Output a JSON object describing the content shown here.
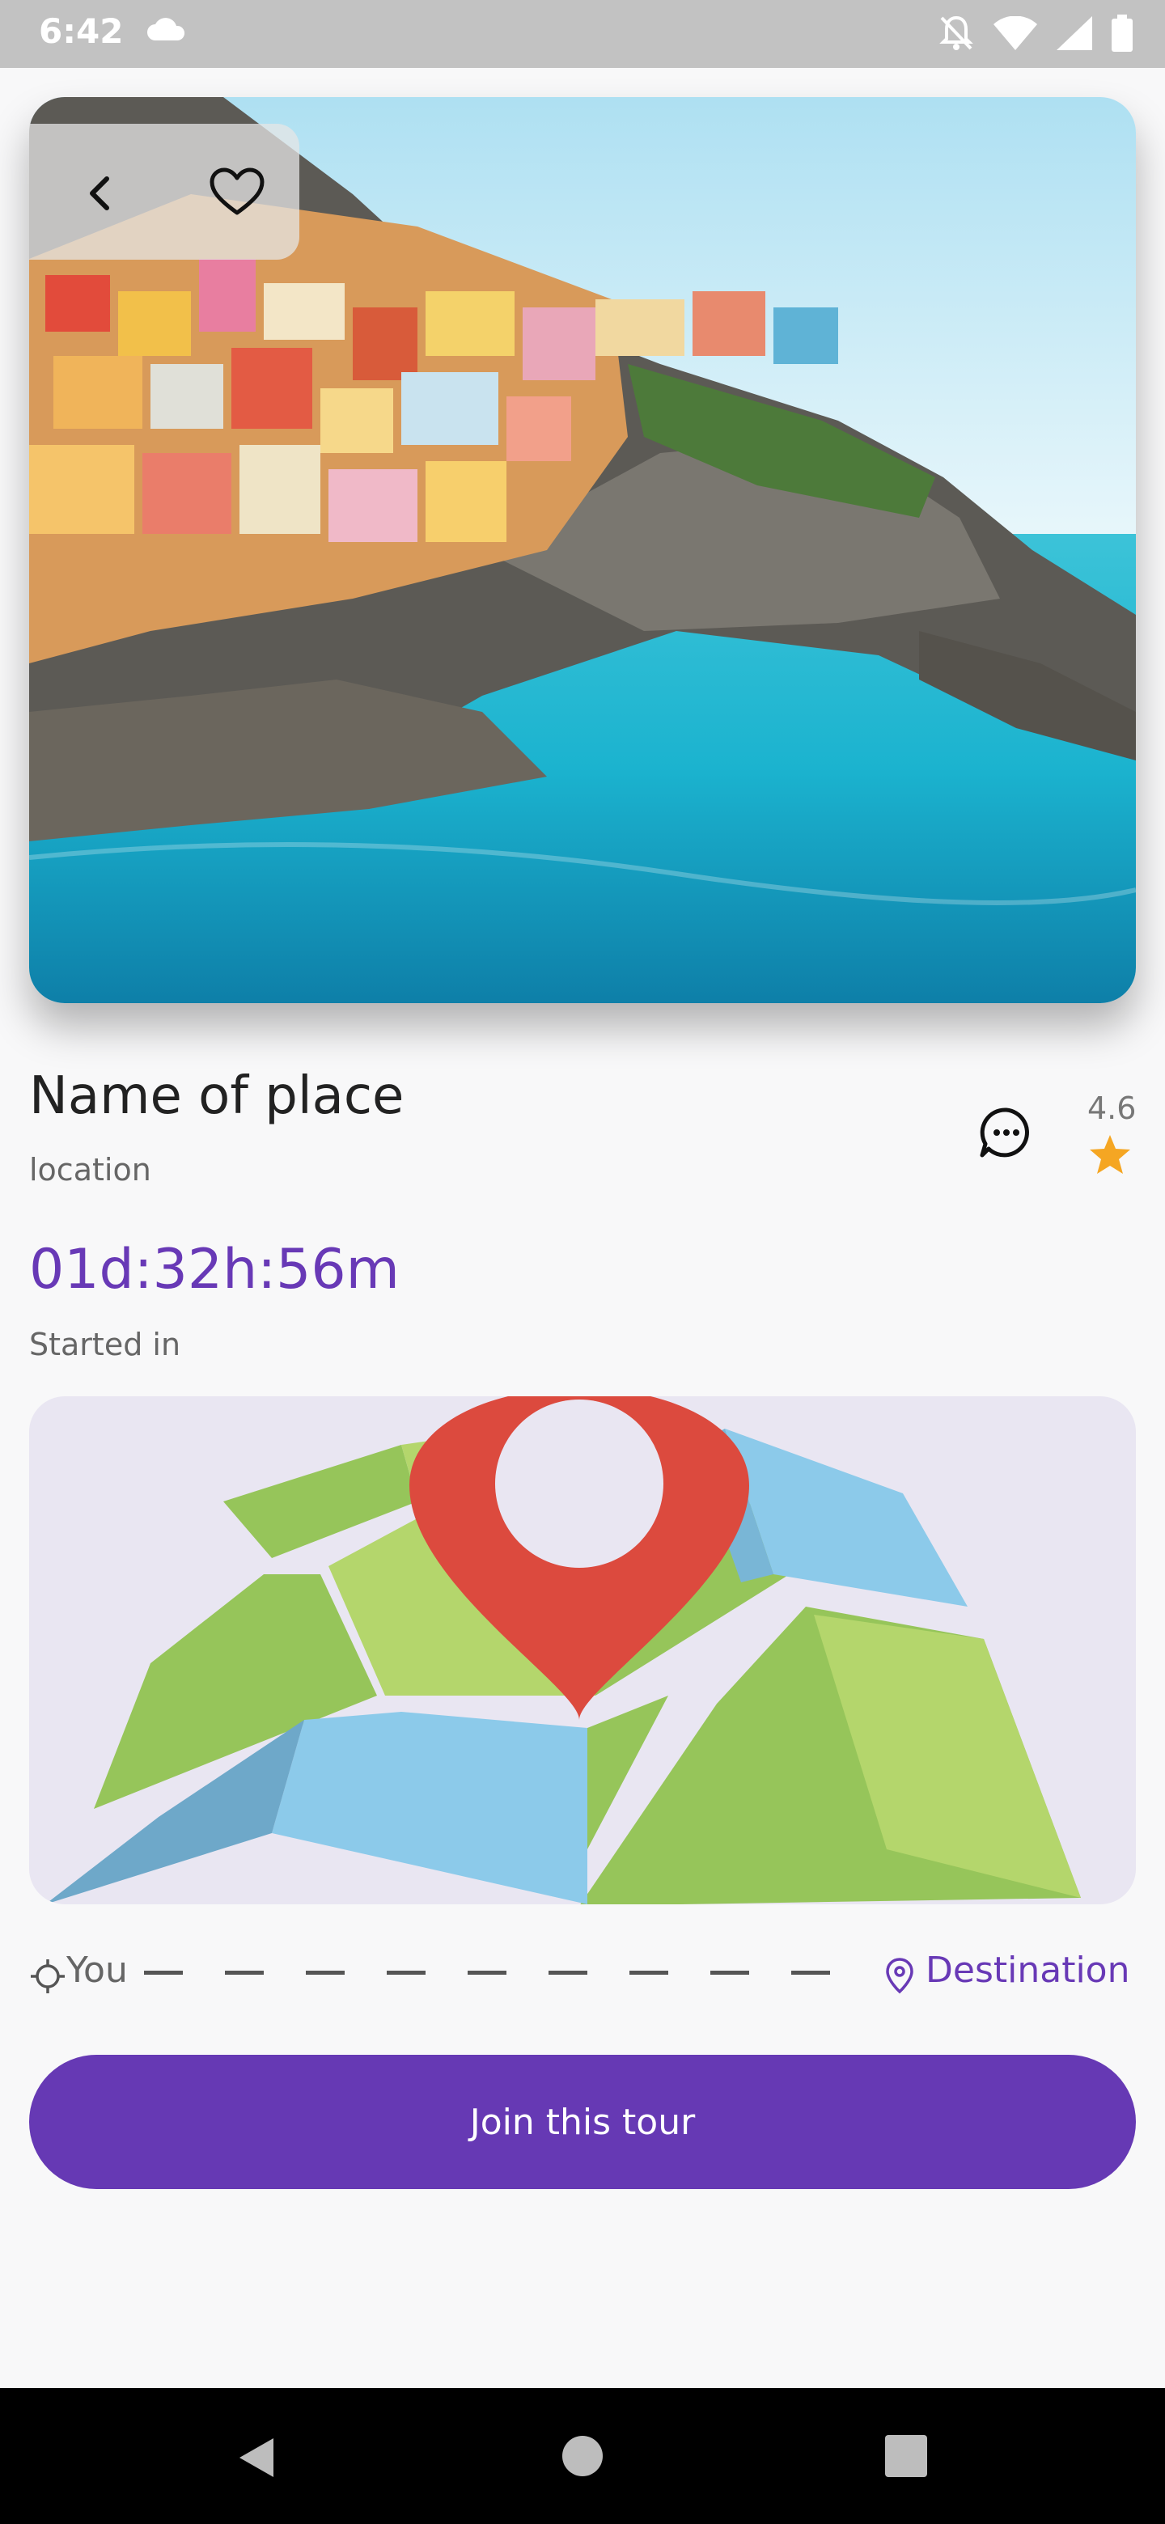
{
  "status_bar": {
    "time": "6:42"
  },
  "place": {
    "name": "Name of place",
    "location": "location",
    "rating": "4.6"
  },
  "tour": {
    "countdown": "01d:32h:56m",
    "started_label": "Started in"
  },
  "route": {
    "start_label": "You",
    "end_label": "Destination"
  },
  "actions": {
    "join_label": "Join this tour"
  },
  "colors": {
    "accent": "#6639b4",
    "star": "#f5a623",
    "pin": "#dc4a3e"
  },
  "icons": [
    "back-arrow-icon",
    "heart-icon",
    "chat-bubble-icon",
    "star-icon",
    "crosshair-icon",
    "location-pin-icon"
  ]
}
